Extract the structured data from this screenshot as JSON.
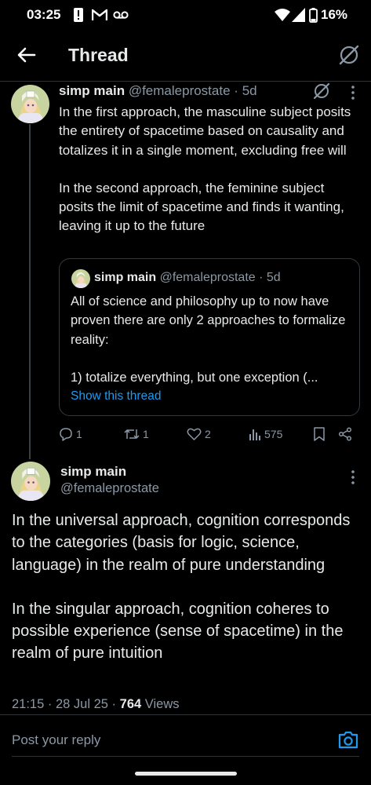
{
  "status_bar": {
    "time": "03:25",
    "battery": "16%"
  },
  "header": {
    "title": "Thread"
  },
  "tweet1": {
    "name": "simp main",
    "handle": "@femaleprostate",
    "age": "5d",
    "paragraphs": [
      "In the first approach, the masculine subject posits the entirety of spacetime based on causality and totalizes it in a single moment, excluding free will",
      "In the second approach, the feminine subject posits the limit of spacetime and finds it wanting, leaving it up to the future"
    ],
    "quote": {
      "name": "simp main",
      "handle": "@femaleprostate",
      "age": "5d",
      "paragraphs": [
        "All of science and philosophy up to now have proven there are only 2 approaches to formalize reality:",
        "1) totalize everything, but one exception (..."
      ],
      "link": "Show this thread"
    },
    "actions": {
      "replies": "1",
      "reposts": "1",
      "likes": "2",
      "views": "575"
    }
  },
  "tweet2": {
    "name": "simp main",
    "handle": "@femaleprostate",
    "paragraphs": [
      "In the universal approach, cognition corresponds to the categories (basis for logic, science, language) in the realm of pure understanding",
      "In the singular approach, cognition coheres to possible experience (sense of spacetime) in the realm of pure intuition"
    ],
    "time": "21:15",
    "date": "28 Jul 25",
    "views_count": "764",
    "views_label": "Views"
  },
  "reply": {
    "placeholder": "Post your reply"
  },
  "icons": {
    "back": "arrow-left-icon",
    "no-sync": "no-sync-icon",
    "more": "more-vertical-icon",
    "reply": "comment-icon",
    "repost": "repost-icon",
    "like": "heart-icon",
    "views": "bar-chart-icon",
    "bookmark": "bookmark-icon",
    "share": "share-icon",
    "camera": "camera-icon"
  },
  "colors": {
    "accent": "#1d9bf0",
    "background": "#000000",
    "secondary_text": "#8b98a5"
  }
}
